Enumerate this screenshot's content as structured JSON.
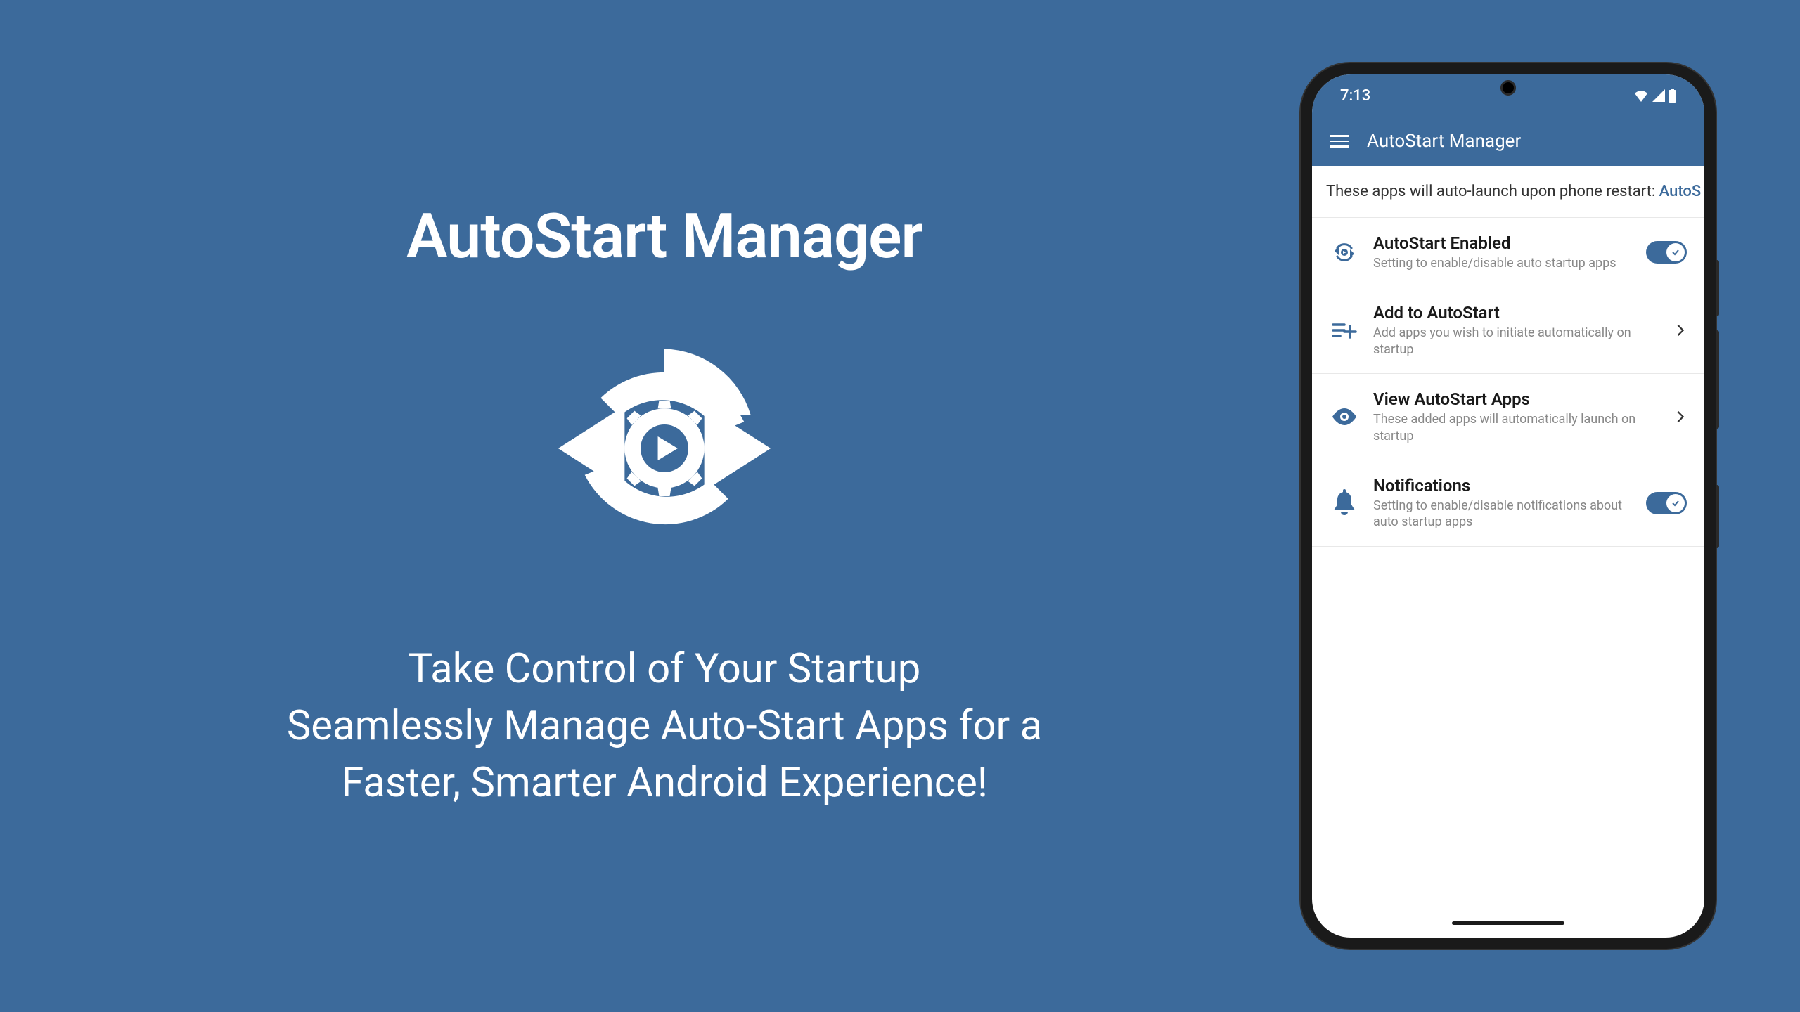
{
  "promo": {
    "title": "AutoStart Manager",
    "tagline_line1": "Take Control of Your Startup",
    "tagline_line2": "Seamlessly Manage Auto-Start Apps for a",
    "tagline_line3": "Faster, Smarter Android Experience!"
  },
  "phone": {
    "status_time": "7:13",
    "header_title": "AutoStart Manager",
    "info_banner_text": "These apps will auto-launch upon phone restart: ",
    "info_banner_highlight": "AutoS",
    "settings": [
      {
        "title": "AutoStart Enabled",
        "subtitle": "Setting to enable/disable auto startup apps",
        "control": "toggle"
      },
      {
        "title": "Add to AutoStart",
        "subtitle": "Add apps you wish to initiate automatically on startup",
        "control": "chevron"
      },
      {
        "title": "View AutoStart Apps",
        "subtitle": "These added apps will automatically launch on startup",
        "control": "chevron"
      },
      {
        "title": "Notifications",
        "subtitle": "Setting to enable/disable notifications about auto startup apps",
        "control": "toggle"
      }
    ]
  }
}
